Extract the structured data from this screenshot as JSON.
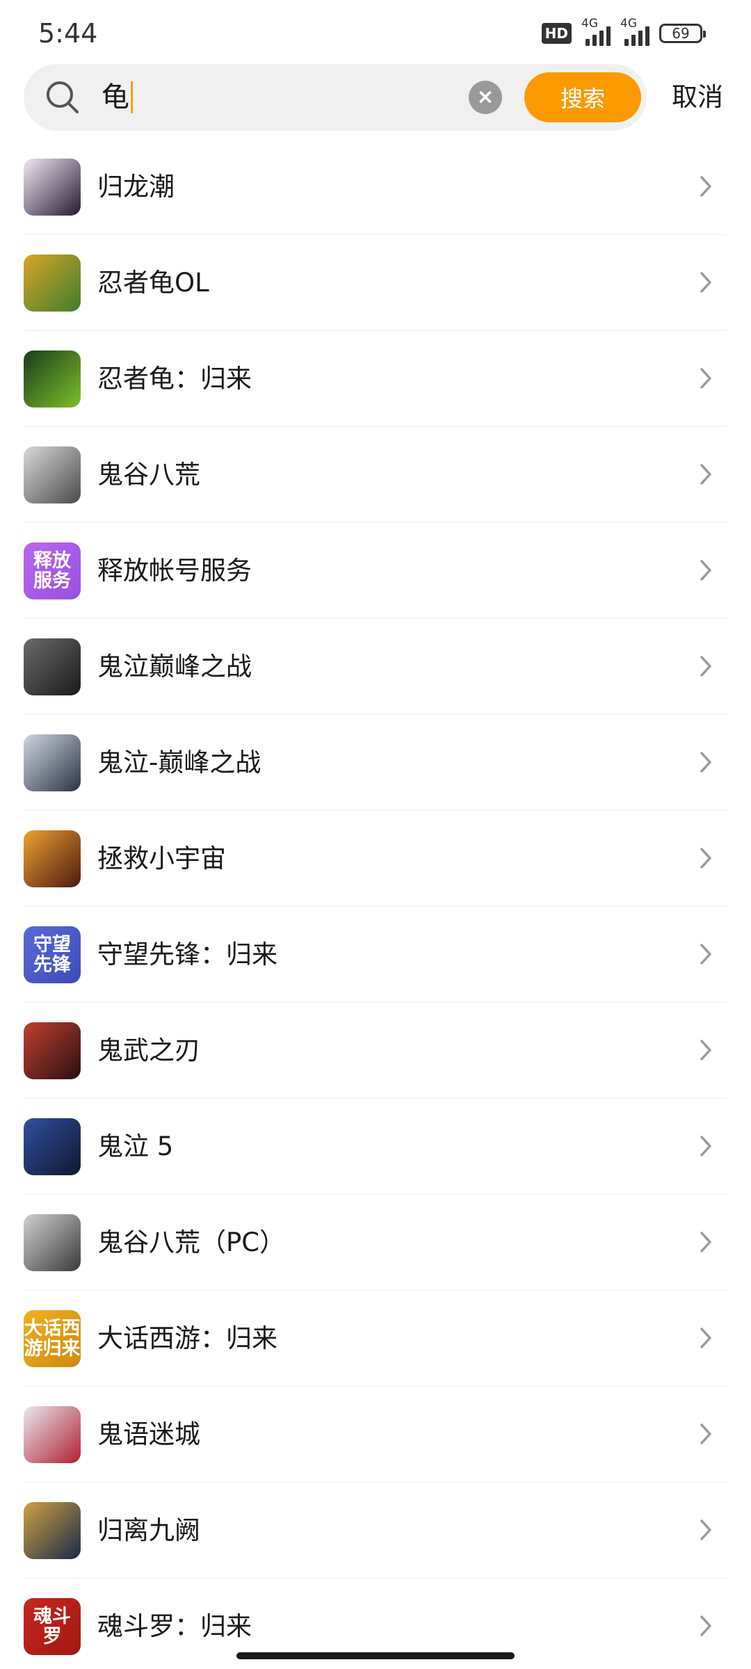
{
  "status_bar": {
    "time": "5:44",
    "hd_badge": "HD",
    "network_1": "4G",
    "network_2": "4G",
    "battery": "69",
    "icons": [
      "signal-icon",
      "signal-icon",
      "battery-icon"
    ]
  },
  "search": {
    "query": "龟",
    "search_label": "搜索",
    "cancel_label": "取消",
    "accent_color": "#fb9a00"
  },
  "results": [
    {
      "title": "归龙潮",
      "icon": "guilongchao-app-icon",
      "icon_text": [
        "",
        ""
      ],
      "icon_colors": [
        "#f3e7f3",
        "#241b33"
      ]
    },
    {
      "title": "忍者龟OL",
      "icon": "ninja-turtles-ol-app-icon",
      "icon_text": [
        "",
        ""
      ],
      "icon_colors": [
        "#d8a52a",
        "#3f7d2a"
      ]
    },
    {
      "title": "忍者龟：归来",
      "icon": "ninja-turtles-return-app-icon",
      "icon_text": [
        "",
        ""
      ],
      "icon_colors": [
        "#1b3b1b",
        "#7dc02a"
      ]
    },
    {
      "title": "鬼谷八荒",
      "icon": "guigu-bahuang-app-icon",
      "icon_text": [
        "",
        ""
      ],
      "icon_colors": [
        "#d9d9d9",
        "#4a4a4a"
      ]
    },
    {
      "title": "释放帐号服务",
      "icon": "release-account-service-app-icon",
      "icon_text": [
        "释放",
        "服务"
      ],
      "icon_colors": [
        "#b868f0",
        "#9a4fe0"
      ]
    },
    {
      "title": "鬼泣巅峰之战",
      "icon": "devil-may-cry-peak-app-icon",
      "icon_text": [
        "",
        ""
      ],
      "icon_colors": [
        "#6b6b6b",
        "#1a1a1a"
      ]
    },
    {
      "title": "鬼泣-巅峰之战",
      "icon": "devil-may-cry-peak-2-app-icon",
      "icon_text": [
        "",
        ""
      ],
      "icon_colors": [
        "#cfd6e0",
        "#2a3448"
      ]
    },
    {
      "title": "拯救小宇宙",
      "icon": "save-universe-app-icon",
      "icon_text": [
        "",
        ""
      ],
      "icon_colors": [
        "#f0a030",
        "#4a1a10"
      ]
    },
    {
      "title": "守望先锋：归来",
      "icon": "overwatch-return-app-icon",
      "icon_text": [
        "守望",
        "先锋"
      ],
      "icon_colors": [
        "#5a6ad8",
        "#3c4bb8"
      ]
    },
    {
      "title": "鬼武之刃",
      "icon": "guiwu-zhiren-app-icon",
      "icon_text": [
        "",
        ""
      ],
      "icon_colors": [
        "#c04030",
        "#2a1010"
      ]
    },
    {
      "title": "鬼泣 5",
      "icon": "devil-may-cry-5-app-icon",
      "icon_text": [
        "",
        ""
      ],
      "icon_colors": [
        "#3050a0",
        "#101830"
      ]
    },
    {
      "title": "鬼谷八荒（PC）",
      "icon": "guigu-bahuang-pc-app-icon",
      "icon_text": [
        "",
        ""
      ],
      "icon_colors": [
        "#d0d0d0",
        "#3a3a3a"
      ]
    },
    {
      "title": "大话西游：归来",
      "icon": "dahua-xiyou-return-app-icon",
      "icon_text": [
        "大话西",
        "游归来"
      ],
      "icon_colors": [
        "#f0b020",
        "#d08a10"
      ]
    },
    {
      "title": "鬼语迷城",
      "icon": "guiyu-micheng-app-icon",
      "icon_text": [
        "",
        ""
      ],
      "icon_colors": [
        "#e8e8f0",
        "#b02030"
      ]
    },
    {
      "title": "归离九阙",
      "icon": "guili-jiuque-app-icon",
      "icon_text": [
        "",
        ""
      ],
      "icon_colors": [
        "#d0a040",
        "#1a2a4a"
      ]
    },
    {
      "title": "魂斗罗：归来",
      "icon": "contra-return-app-icon",
      "icon_text": [
        "魂斗",
        "罗"
      ],
      "icon_colors": [
        "#c8281e",
        "#a01810"
      ]
    }
  ]
}
